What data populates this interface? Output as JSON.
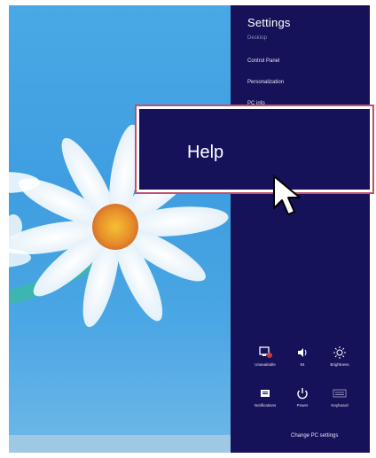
{
  "panel": {
    "title": "Settings",
    "subtitle": "Desktop",
    "links": [
      "Control Panel",
      "Personalization",
      "PC info"
    ]
  },
  "help": {
    "label": "Help"
  },
  "quick_settings": [
    {
      "label": "Unavailable",
      "icon": "network-unavailable-icon"
    },
    {
      "label": "94",
      "icon": "volume-icon"
    },
    {
      "label": "Brightness",
      "icon": "brightness-icon"
    },
    {
      "label": "Notifications",
      "icon": "notifications-icon"
    },
    {
      "label": "Power",
      "icon": "power-icon"
    },
    {
      "label": "Keyboard",
      "icon": "keyboard-icon"
    }
  ],
  "footer": {
    "change_pc_settings": "Change PC settings"
  },
  "colors": {
    "panel_bg": "#15125a",
    "highlight_border": "#c44d6e",
    "desktop_blue": "#3f9ee0"
  }
}
